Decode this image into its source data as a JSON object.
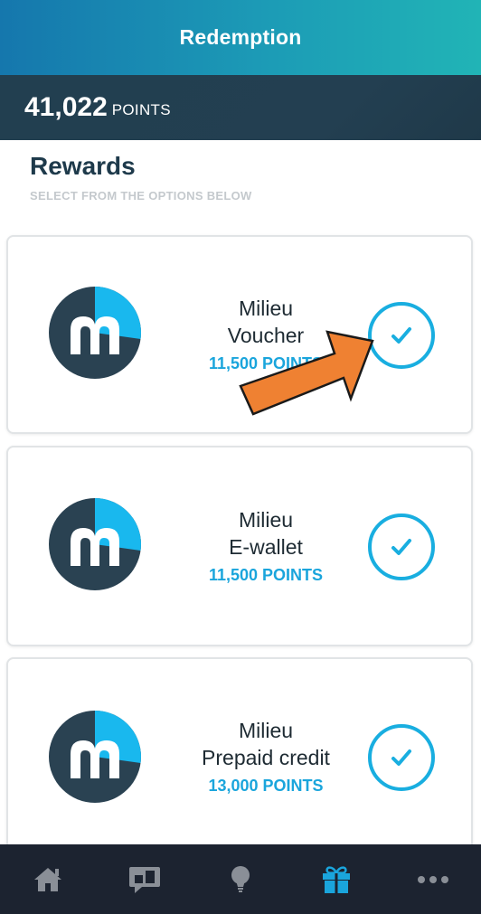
{
  "header": {
    "title": "Redemption"
  },
  "points": {
    "value": "41,022",
    "unit": "POINTS"
  },
  "section": {
    "title": "Rewards",
    "subtitle": "SELECT FROM THE OPTIONS BELOW"
  },
  "rewards": [
    {
      "line1": "Milieu",
      "line2": "Voucher",
      "points": "11,500 POINTS",
      "logo_icon": "milieu-logo-icon"
    },
    {
      "line1": "Milieu",
      "line2": "E-wallet",
      "points": "11,500 POINTS",
      "logo_icon": "milieu-logo-icon"
    },
    {
      "line1": "Milieu",
      "line2": "Prepaid credit",
      "points": "13,000 POINTS",
      "logo_icon": "milieu-logo-icon"
    }
  ],
  "tabbar": {
    "items": [
      {
        "icon": "home-icon",
        "active": false
      },
      {
        "icon": "chat-icon",
        "active": false
      },
      {
        "icon": "lightbulb-icon",
        "active": false
      },
      {
        "icon": "gift-icon",
        "active": true
      },
      {
        "icon": "more-icon",
        "active": false
      }
    ]
  },
  "colors": {
    "accent": "#1aa5dc",
    "header_start": "#1577ad",
    "header_end": "#21b4b6",
    "points_bar": "#223f50",
    "tabbar": "#1c2330",
    "arrow": "#ef8132"
  }
}
